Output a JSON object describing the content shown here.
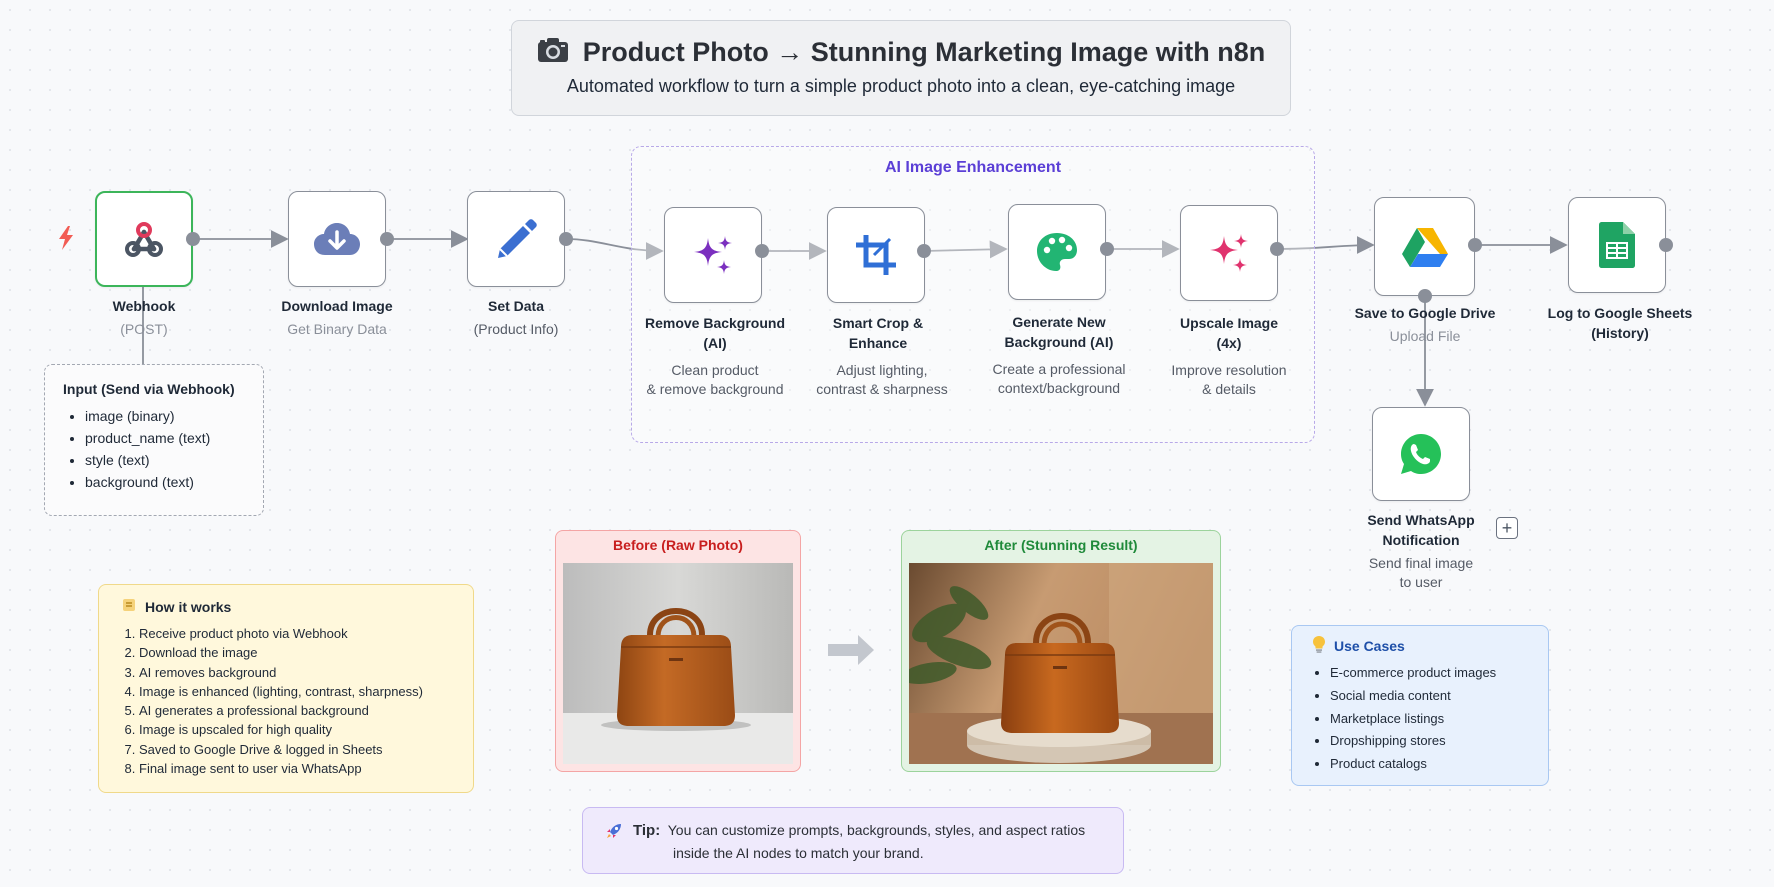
{
  "header": {
    "title": "Product Photo → Stunning Marketing Image with n8n",
    "subtitle": "Automated workflow to turn a simple product photo into a clean, eye-catching image",
    "icon": "camera-icon"
  },
  "group": {
    "title": "AI Image Enhancement"
  },
  "nodes": [
    {
      "id": "webhook",
      "label": "Webhook",
      "sub": "(POST)",
      "icon": "webhook-icon"
    },
    {
      "id": "download",
      "label": "Download Image",
      "sub": "Get Binary Data",
      "icon": "cloud-download-icon"
    },
    {
      "id": "setdata",
      "label": "Set Data",
      "sub": "(Product Info)",
      "icon": "pencil-icon"
    },
    {
      "id": "removebg",
      "label_line1": "Remove Background",
      "label_line2": "(AI)",
      "sub_line1": "Clean product",
      "sub_line2": "& remove background",
      "icon": "sparkles-icon"
    },
    {
      "id": "crop",
      "label_line1": "Smart Crop &",
      "label_line2": "Enhance",
      "sub_line1": "Adjust lighting,",
      "sub_line2": "contrast & sharpness",
      "icon": "crop-icon"
    },
    {
      "id": "genbg",
      "label_line1": "Generate New",
      "label_line2": "Background (AI)",
      "sub_line1": "Create a professional",
      "sub_line2": "context/background",
      "icon": "palette-icon"
    },
    {
      "id": "upscale",
      "label_line1": "Upscale Image",
      "label_line2": "(4x)",
      "sub_line1": "Improve resolution",
      "sub_line2": "& details",
      "icon": "sparkles-pink-icon"
    },
    {
      "id": "drive",
      "label": "Save to Google Drive",
      "sub": "Upload File",
      "icon": "google-drive-icon"
    },
    {
      "id": "sheets",
      "label_line1": "Log to Google Sheets",
      "label_line2": "(History)",
      "icon": "google-sheets-icon"
    },
    {
      "id": "whatsapp",
      "label_line1": "Send WhatsApp",
      "label_line2": "Notification",
      "sub_line1": "Send final image",
      "sub_line2": "to user",
      "icon": "whatsapp-icon"
    }
  ],
  "input_note": {
    "title": "Input (Send via Webhook)",
    "items": [
      "image (binary)",
      "product_name (text)",
      "style (text)",
      "background (text)"
    ]
  },
  "how_it_works": {
    "title": "How it works",
    "icon": "scroll-icon",
    "steps": [
      "Receive product photo via Webhook",
      "Download the image",
      "AI removes background",
      "Image is enhanced (lighting, contrast, sharpness)",
      "AI generates a professional background",
      "Image is upscaled for high quality",
      "Saved to Google Drive & logged in Sheets",
      "Final image sent to user via WhatsApp"
    ]
  },
  "before": {
    "title": "Before (Raw Photo)"
  },
  "after": {
    "title": "After (Stunning Result)"
  },
  "use_cases": {
    "title": "Use Cases",
    "icon": "lightbulb-icon",
    "items": [
      "E-commerce product images",
      "Social media content",
      "Marketplace listings",
      "Dropshipping stores",
      "Product catalogs"
    ]
  },
  "tip": {
    "label": "Tip:",
    "line1": "You can customize prompts, backgrounds, styles, and aspect ratios",
    "line2": "inside the AI nodes to match your brand.",
    "icon": "rocket-icon"
  },
  "add_button": {
    "label": "+"
  },
  "colors": {
    "trigger_border": "#3cb55a",
    "group_title": "#5b3fd6",
    "bag": "#b8621e"
  }
}
